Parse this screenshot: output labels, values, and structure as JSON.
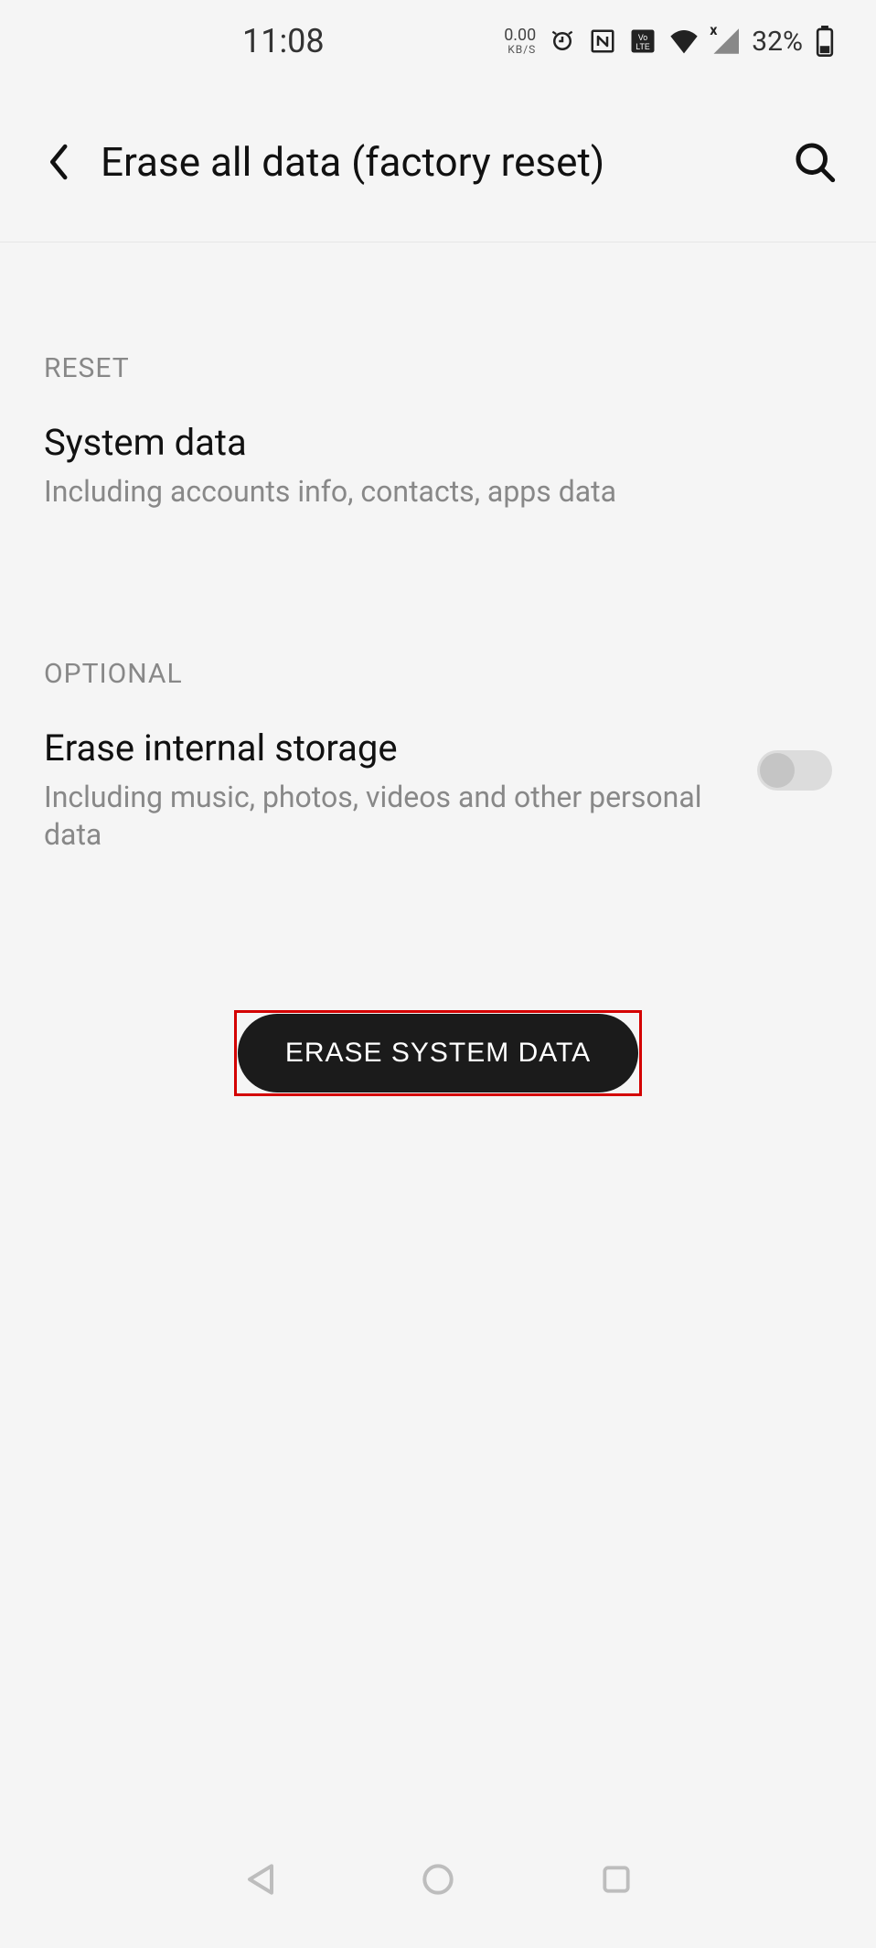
{
  "status": {
    "time": "11:08",
    "net_speed_value": "0.00",
    "net_speed_unit": "KB/S",
    "battery_percent": "32%",
    "signal_x": "x"
  },
  "header": {
    "title": "Erase all data (factory reset)"
  },
  "sections": {
    "reset": {
      "label": "RESET",
      "system_data_title": "System data",
      "system_data_desc": "Including accounts info, contacts, apps data"
    },
    "optional": {
      "label": "OPTIONAL",
      "erase_storage_title": "Erase internal storage",
      "erase_storage_desc": "Including music, photos, videos and other personal data",
      "erase_storage_toggle": false
    }
  },
  "erase_button_label": "ERASE SYSTEM DATA"
}
